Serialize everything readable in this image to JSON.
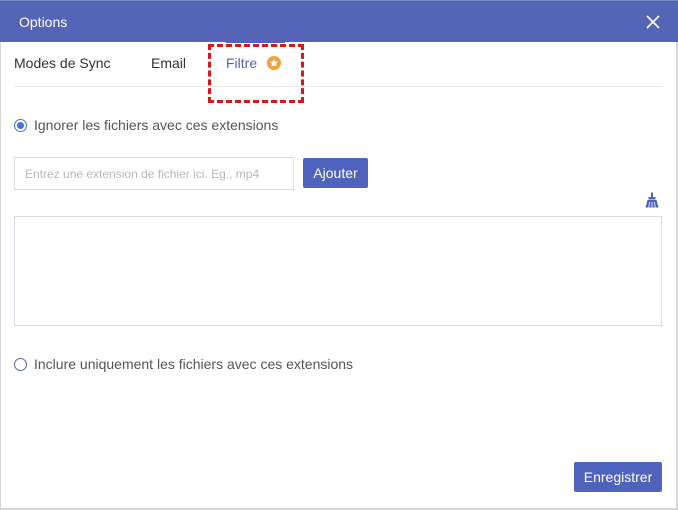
{
  "window": {
    "title": "Options",
    "close_icon": "close-icon"
  },
  "tabs": [
    {
      "label": "Modes de Sync",
      "active": false
    },
    {
      "label": "Email",
      "active": false
    },
    {
      "label": "Filtre",
      "active": true,
      "badge_icon": "star-badge-icon"
    }
  ],
  "filter": {
    "exclude_option_label": "Ignorer les fichiers avec ces extensions",
    "exclude_selected": true,
    "extension_input": {
      "value": "",
      "placeholder": "Entrez une extension de fichier ici. Eg., mp4"
    },
    "add_button_label": "Ajouter",
    "clear_icon": "broom-icon",
    "extensions": [],
    "include_option_label": "Inclure uniquement les fichiers avec ces extensions",
    "include_selected": false
  },
  "footer": {
    "save_button_label": "Enregistrer"
  },
  "colors": {
    "accent": "#5465b8",
    "button": "#4f62bc",
    "radio_checked": "#3f73d9",
    "badge": "#f1a33a",
    "highlight": "#d9161c"
  }
}
